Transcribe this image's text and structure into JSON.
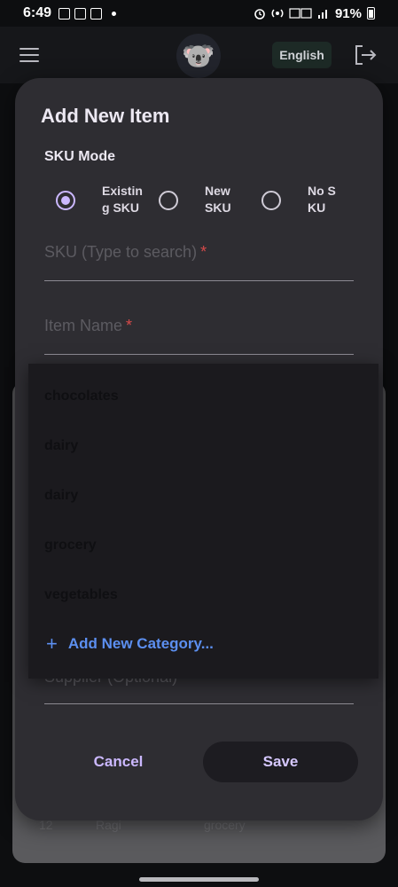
{
  "status_bar": {
    "time": "6:49",
    "battery": "91%"
  },
  "app_bar": {
    "avatar_emoji": "🐨",
    "language_button": "English"
  },
  "background_table": {
    "row": [
      "12",
      "Ragi",
      "grocery"
    ]
  },
  "dialog": {
    "title": "Add New Item",
    "sku_mode_label": "SKU Mode",
    "sku_options": [
      {
        "label": "Existing SKU",
        "selected": true
      },
      {
        "label": "New SKU",
        "selected": false
      },
      {
        "label": "No SKU",
        "selected": false
      }
    ],
    "sku_field": {
      "placeholder": "SKU (Type to search)",
      "required_mark": "*"
    },
    "item_name_field": {
      "placeholder": "Item Name",
      "required_mark": "*"
    },
    "supplier_field": {
      "placeholder": "Supplier (Optional)"
    },
    "cancel_label": "Cancel",
    "save_label": "Save"
  },
  "category_dropdown": {
    "items": [
      "chocolates",
      "dairy",
      "dairy",
      "grocery",
      "vegetables"
    ],
    "add_label": "Add New Category..."
  },
  "colors": {
    "accent": "#cbb8ff",
    "link": "#5c8ff0",
    "required": "#d64a4a",
    "dialog_bg": "#2e2d32"
  }
}
